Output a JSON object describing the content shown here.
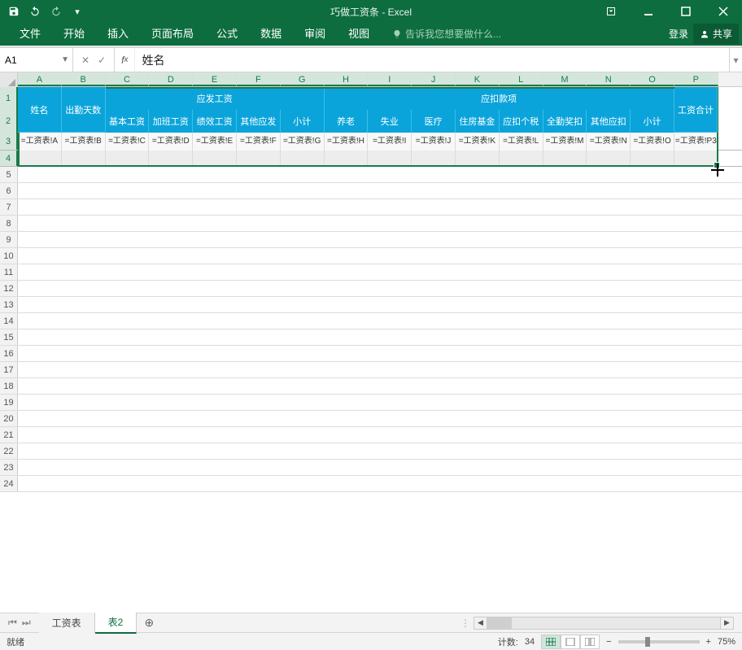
{
  "title": "巧做工资条 - Excel",
  "qat": {
    "save_title": "保存",
    "undo_title": "撤销",
    "redo_title": "重做"
  },
  "window_buttons": {
    "opts_title": "功能区选项",
    "min_title": "最小化",
    "max_title": "最大化",
    "close_title": "关闭"
  },
  "ribbon": {
    "tabs": [
      "文件",
      "开始",
      "插入",
      "页面布局",
      "公式",
      "数据",
      "审阅",
      "视图"
    ],
    "tell_me": "告诉我您想要做什么...",
    "login": "登录",
    "share": "共享"
  },
  "name_box": "A1",
  "formula": "姓名",
  "columns": [
    "A",
    "B",
    "C",
    "D",
    "E",
    "F",
    "G",
    "H",
    "I",
    "J",
    "K",
    "L",
    "M",
    "N",
    "O",
    "P"
  ],
  "row_numbers": [
    "1",
    "2",
    "3",
    "4",
    "5",
    "6",
    "7",
    "8",
    "9",
    "10",
    "11",
    "12",
    "13",
    "14",
    "15",
    "16",
    "17",
    "18",
    "19",
    "20",
    "21",
    "22",
    "23",
    "24"
  ],
  "header": {
    "name": "姓名",
    "attendance": "出勤天数",
    "yingfa": "应发工资",
    "yingkou": "应扣款项",
    "total": "工资合计",
    "sub": [
      "基本工资",
      "加班工资",
      "绩效工资",
      "其他应发",
      "小计",
      "养老",
      "失业",
      "医疗",
      "住房基金",
      "应扣个税",
      "全勤奖扣",
      "其他应扣",
      "小计"
    ]
  },
  "row3": [
    "=工资表!A",
    "=工资表!B",
    "=工资表!C",
    "=工资表!D",
    "=工资表!E",
    "=工资表!F",
    "=工资表!G",
    "=工资表!H",
    "=工资表!I",
    "=工资表!J",
    "=工资表!K",
    "=工资表!L",
    "=工资表!M",
    "=工资表!N",
    "=工资表!O",
    "=工资表!P3"
  ],
  "sheets": {
    "nav_first": "⏮",
    "nav_last": "⏭",
    "tabs": [
      "工资表",
      "表2"
    ],
    "active": 1,
    "new": "⊕"
  },
  "status": {
    "ready": "就绪",
    "count_label": "计数:",
    "count": "34",
    "zoom": "75%",
    "minus": "−",
    "plus": "+"
  },
  "chart_data": null
}
